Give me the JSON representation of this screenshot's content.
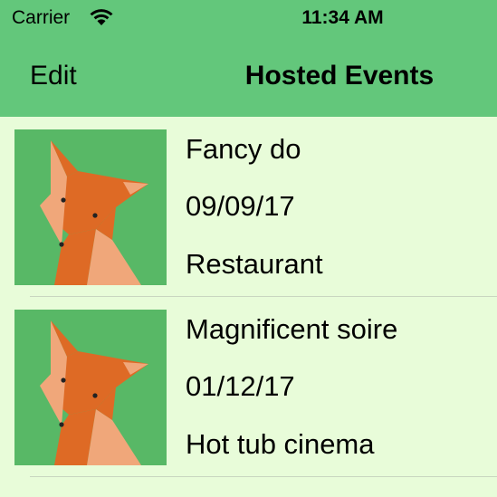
{
  "status_bar": {
    "carrier": "Carrier",
    "time": "11:34 AM",
    "wifi_icon": "wifi-icon"
  },
  "nav": {
    "edit_label": "Edit",
    "title": "Hosted Events",
    "background_color": "#63c77b"
  },
  "list_background_color": "#e8fcd9",
  "events": [
    {
      "name": "Fancy do",
      "date": "09/09/17",
      "venue": "Restaurant",
      "image": "fox-image"
    },
    {
      "name": "Magnificent soire",
      "date": "01/12/17",
      "venue": "Hot tub cinema",
      "image": "fox-image"
    }
  ]
}
